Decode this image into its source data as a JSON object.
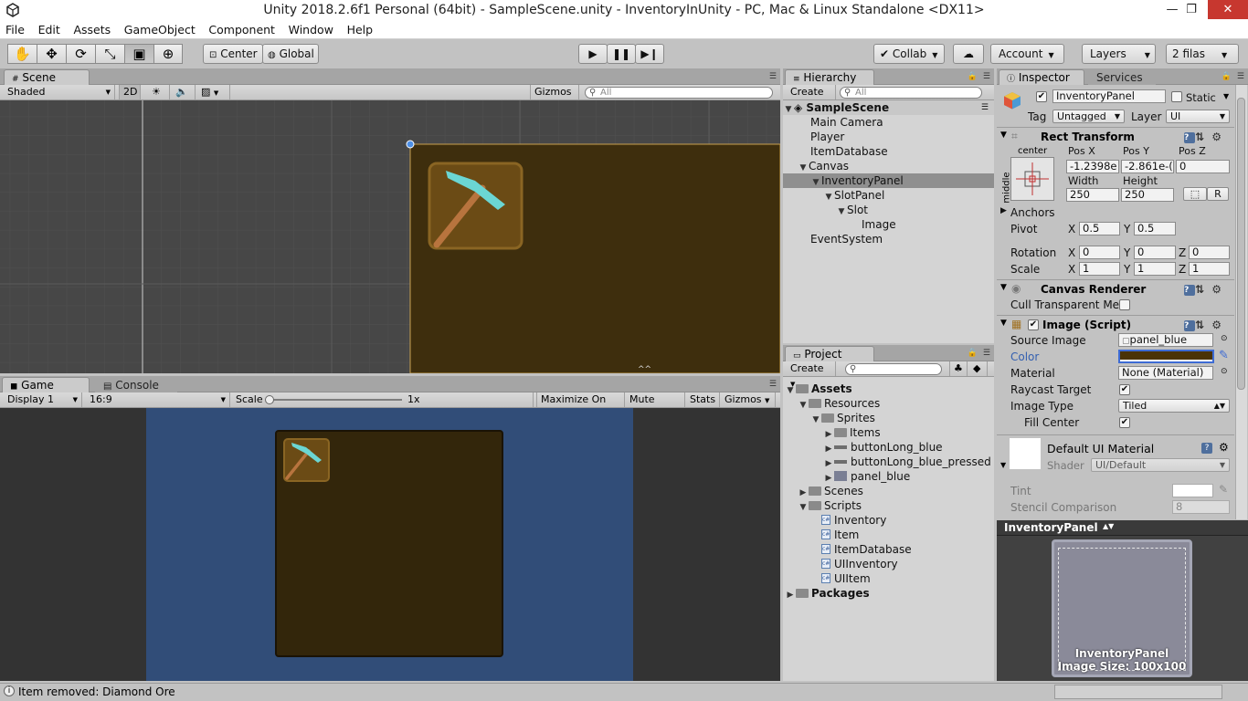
{
  "window": {
    "title": "Unity 2018.2.6f1 Personal (64bit) - SampleScene.unity - InventoryInUnity - PC, Mac & Linux Standalone <DX11>",
    "controls": {
      "minimize": "—",
      "maximize": "❐",
      "close": "✕"
    }
  },
  "menu": [
    "File",
    "Edit",
    "Assets",
    "GameObject",
    "Component",
    "Window",
    "Help"
  ],
  "toolbar": {
    "tools": [
      "hand-icon",
      "move-icon",
      "rotate-icon",
      "scale-icon",
      "rect-icon",
      "transform-icon"
    ],
    "pivot": "Center",
    "space": "Global",
    "collab": "Collab",
    "account": "Account",
    "layers": "Layers",
    "layout": "2 filas"
  },
  "scene": {
    "tab": "Scene",
    "shading": "Shaded",
    "mode_2d": "2D",
    "gizmos": "Gizmos",
    "search_placeholder": "All"
  },
  "game": {
    "tab": "Game",
    "console_tab": "Console",
    "display": "Display 1",
    "aspect": "16:9",
    "scale_label": "Scale",
    "scale_value": "1x",
    "scale_fraction": 0.0,
    "maximize": "Maximize On Play",
    "mute": "Mute Audio",
    "stats": "Stats",
    "gizmos": "Gizmos"
  },
  "hierarchy": {
    "tab": "Hierarchy",
    "create": "Create",
    "search_placeholder": "All",
    "scene": "SampleScene",
    "items": [
      {
        "label": "Main Camera",
        "depth": 0,
        "expanded": null
      },
      {
        "label": "Player",
        "depth": 0,
        "expanded": null
      },
      {
        "label": "ItemDatabase",
        "depth": 0,
        "expanded": null
      },
      {
        "label": "Canvas",
        "depth": 0,
        "expanded": true
      },
      {
        "label": "InventoryPanel",
        "depth": 1,
        "expanded": true,
        "selected": true
      },
      {
        "label": "SlotPanel",
        "depth": 2,
        "expanded": true
      },
      {
        "label": "Slot",
        "depth": 3,
        "expanded": true
      },
      {
        "label": "Image",
        "depth": 4,
        "expanded": null
      },
      {
        "label": "EventSystem",
        "depth": 0,
        "expanded": null
      }
    ]
  },
  "project": {
    "tab": "Project",
    "create": "Create",
    "items": [
      {
        "label": "Assets",
        "depth": 0,
        "type": "folder",
        "expanded": true,
        "bold": true
      },
      {
        "label": "Resources",
        "depth": 1,
        "type": "folder",
        "expanded": true
      },
      {
        "label": "Sprites",
        "depth": 2,
        "type": "folder",
        "expanded": true
      },
      {
        "label": "Items",
        "depth": 3,
        "type": "folder",
        "expanded": false
      },
      {
        "label": "buttonLong_blue",
        "depth": 3,
        "type": "sprite",
        "expanded": false
      },
      {
        "label": "buttonLong_blue_pressed",
        "depth": 3,
        "type": "sprite",
        "expanded": false
      },
      {
        "label": "panel_blue",
        "depth": 3,
        "type": "spritesq",
        "expanded": false
      },
      {
        "label": "Scenes",
        "depth": 1,
        "type": "folder",
        "expanded": false
      },
      {
        "label": "Scripts",
        "depth": 1,
        "type": "folder",
        "expanded": true
      },
      {
        "label": "Inventory",
        "depth": 2,
        "type": "script",
        "expanded": null
      },
      {
        "label": "Item",
        "depth": 2,
        "type": "script",
        "expanded": null
      },
      {
        "label": "ItemDatabase",
        "depth": 2,
        "type": "script",
        "expanded": null
      },
      {
        "label": "UIInventory",
        "depth": 2,
        "type": "script",
        "expanded": null
      },
      {
        "label": "UIItem",
        "depth": 2,
        "type": "script",
        "expanded": null
      },
      {
        "label": "Packages",
        "depth": 0,
        "type": "folder",
        "expanded": false,
        "bold": true
      }
    ]
  },
  "inspector": {
    "tab": "Inspector",
    "services_tab": "Services",
    "object_name": "InventoryPanel",
    "static_label": "Static",
    "tag_label": "Tag",
    "tag_value": "Untagged",
    "layer_label": "Layer",
    "layer_value": "UI",
    "rect_transform": {
      "title": "Rect Transform",
      "anchor_h": "center",
      "anchor_v": "middle",
      "posx_label": "Pos X",
      "posx": "-1.2398e",
      "posy_label": "Pos Y",
      "posy": "-2.861e-(",
      "posz_label": "Pos Z",
      "posz": "0",
      "width_label": "Width",
      "width": "250",
      "height_label": "Height",
      "height": "250",
      "r_button": "R",
      "anchors": "Anchors",
      "pivot_label": "Pivot",
      "pivot_x": "0.5",
      "pivot_y": "0.5",
      "rotation_label": "Rotation",
      "rot_x": "0",
      "rot_y": "0",
      "rot_z": "0",
      "scale_label": "Scale",
      "scale_x": "1",
      "scale_y": "1",
      "scale_z": "1",
      "x": "X",
      "y": "Y",
      "z": "Z"
    },
    "canvas_renderer": {
      "title": "Canvas Renderer",
      "cull": "Cull Transparent Me"
    },
    "image_script": {
      "title": "Image (Script)",
      "source_label": "Source Image",
      "source_value": "panel_blue",
      "color_label": "Color",
      "color_value": "#4a3306",
      "material_label": "Material",
      "material_value": "None (Material)",
      "raycast_label": "Raycast Target",
      "image_type_label": "Image Type",
      "image_type_value": "Tiled",
      "fill_center_label": "Fill Center"
    },
    "material": {
      "title": "Default UI Material",
      "shader_label": "Shader",
      "shader_value": "UI/Default",
      "tint_label": "Tint",
      "stencil_label": "Stencil Comparison",
      "stencil_value": "8"
    },
    "preview": {
      "title": "InventoryPanel",
      "caption1": "InventoryPanel",
      "caption2": "Image Size: 100x100"
    }
  },
  "status": {
    "message": "Item removed: Diamond Ore"
  }
}
